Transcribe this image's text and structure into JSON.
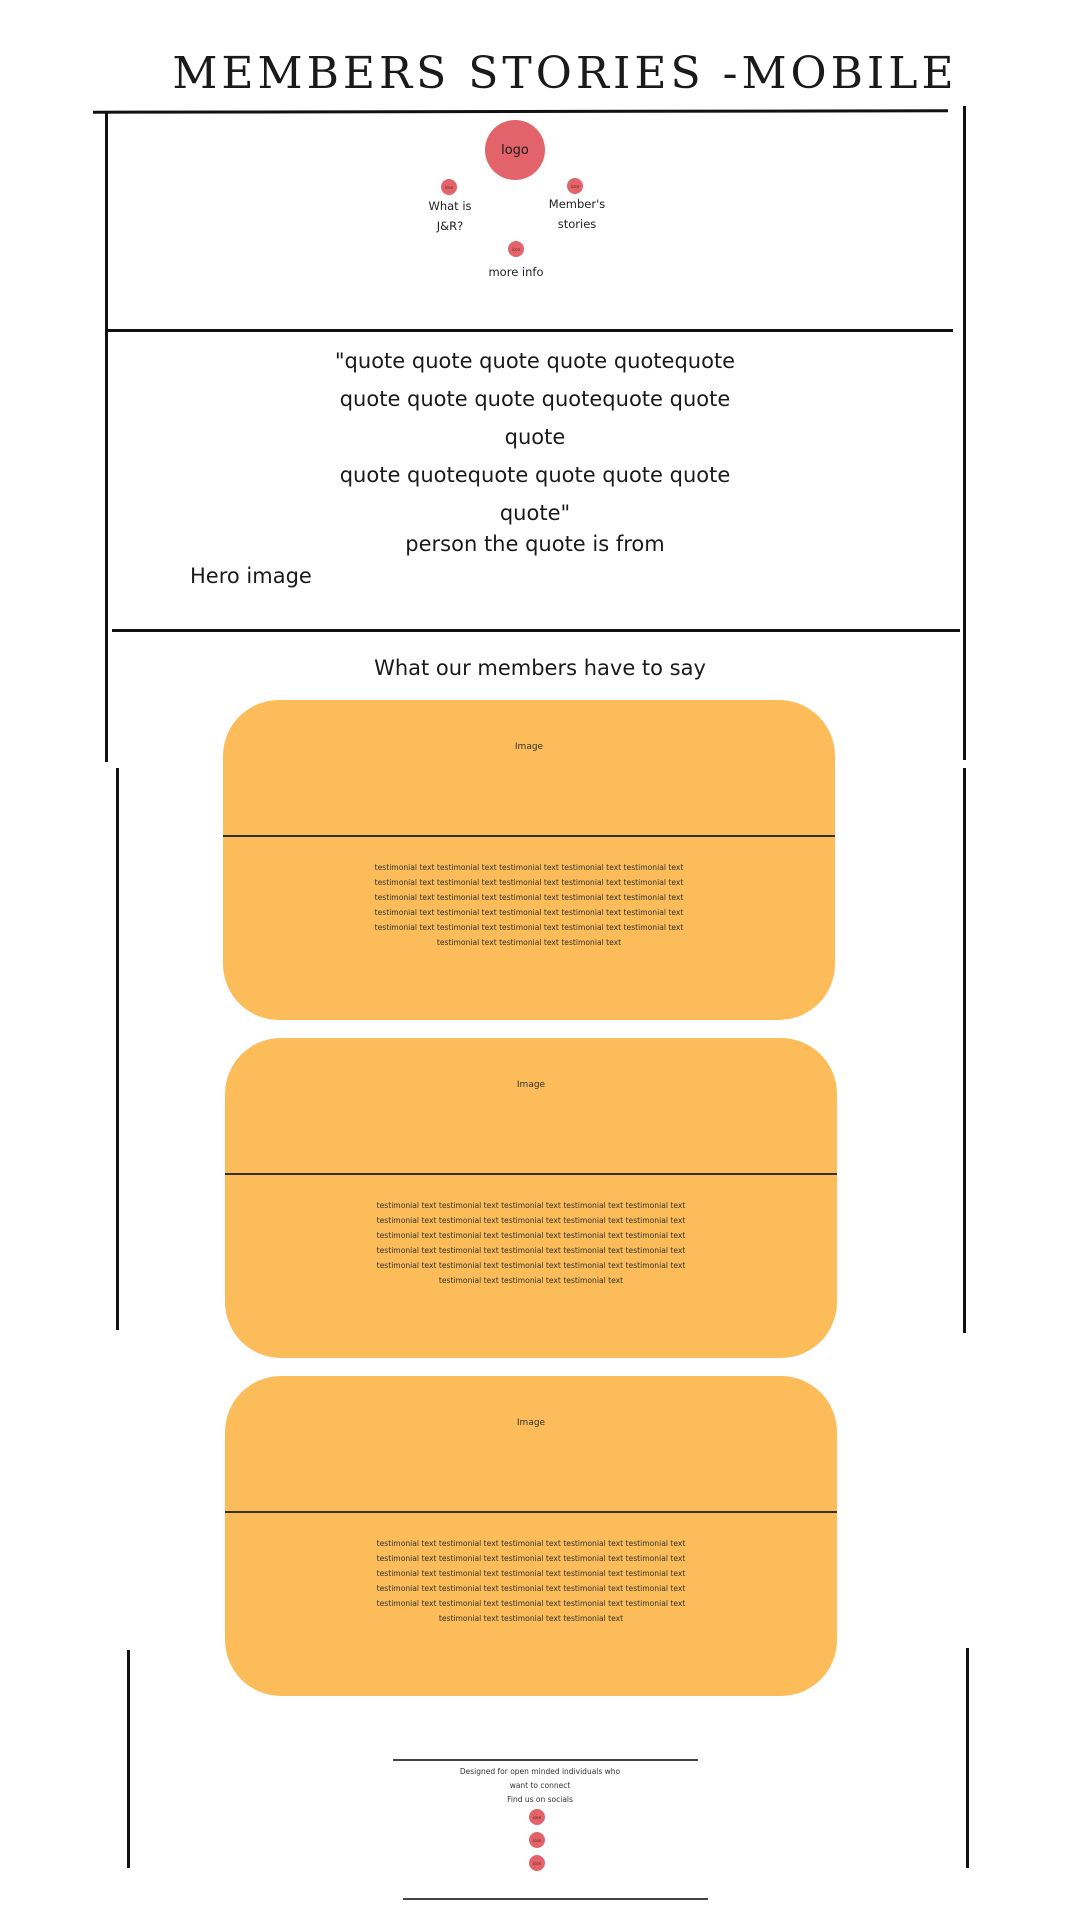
{
  "page_title": "MEMBERS STORIES -MOBILE",
  "header": {
    "logo": "logo",
    "nav": {
      "what_is_dot": "icon",
      "what_is_label_line1": "What is",
      "what_is_label_line2": "J&R?",
      "members_dot": "icon",
      "members_label_line1": "Member's",
      "members_label_line2": "stories",
      "more_dot": "icon",
      "more_label": "more info"
    }
  },
  "hero": {
    "quote_lines": [
      "\"quote quote quote quote quotequote",
      "quote quote quote quotequote quote quote",
      "quote quotequote quote quote quote",
      "quote\""
    ],
    "author": "person the quote is from",
    "label": "Hero image"
  },
  "testimonials": {
    "title": "What our members have to say",
    "cards": [
      {
        "image_label": "Image",
        "text_lines": [
          "testimonial text testimonial text testimonial text testimonial text testimonial text",
          "testimonial text testimonial text testimonial text testimonial text testimonial text",
          "testimonial text testimonial text testimonial text testimonial text testimonial text",
          "testimonial text testimonial text testimonial text testimonial text testimonial text",
          "testimonial text testimonial text testimonial text testimonial text testimonial text",
          "testimonial text testimonial text testimonial text"
        ]
      },
      {
        "image_label": "Image",
        "text_lines": [
          "testimonial text testimonial text testimonial text testimonial text testimonial text",
          "testimonial text testimonial text testimonial text testimonial text testimonial text",
          "testimonial text testimonial text testimonial text testimonial text testimonial text",
          "testimonial text testimonial text testimonial text testimonial text testimonial text",
          "testimonial text testimonial text testimonial text testimonial text testimonial text",
          "testimonial text testimonial text testimonial text"
        ]
      },
      {
        "image_label": "Image",
        "text_lines": [
          "testimonial text testimonial text testimonial text testimonial text testimonial text",
          "testimonial text testimonial text testimonial text testimonial text testimonial text",
          "testimonial text testimonial text testimonial text testimonial text testimonial text",
          "testimonial text testimonial text testimonial text testimonial text testimonial text",
          "testimonial text testimonial text testimonial text testimonial text testimonial text",
          "testimonial text testimonial text testimonial text"
        ]
      }
    ]
  },
  "footer": {
    "tagline_line1": "Designed for open minded individuals who",
    "tagline_line2": "want to connect",
    "socials_label": "Find us on socials",
    "social_icons": [
      "icon",
      "icon",
      "icon"
    ]
  },
  "colors": {
    "accent": "#e2646a",
    "card": "#fcbc5a"
  }
}
